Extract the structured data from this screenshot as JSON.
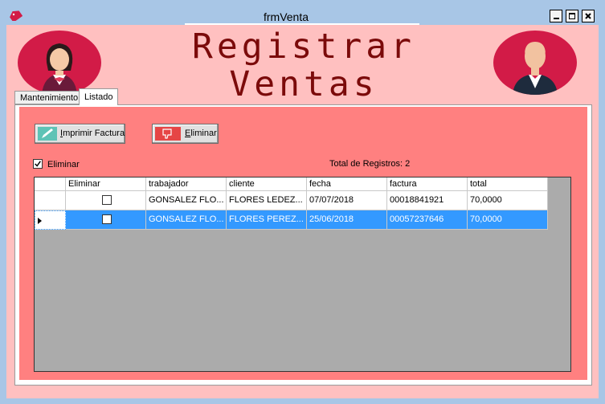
{
  "window": {
    "title": "frmVenta"
  },
  "header": {
    "line1": "Registrar",
    "line2": "Ventas"
  },
  "tabs": [
    {
      "label": "Mantenimiento"
    },
    {
      "label": "Listado"
    }
  ],
  "toolbar": {
    "print_prefix": "I",
    "print_rest": "mprimir Factura",
    "delete_prefix": "E",
    "delete_rest": "liminar"
  },
  "delete_checkbox": {
    "label": "Eliminar",
    "checked": true
  },
  "total": {
    "label": "Total de Registros:",
    "count": "2"
  },
  "table": {
    "columns": [
      "Eliminar",
      "trabajador",
      "cliente",
      "fecha",
      "factura",
      "total"
    ],
    "rows": [
      {
        "eliminar": false,
        "trabajador": "GONSALEZ FLO...",
        "cliente": "FLORES LEDEZ...",
        "fecha": "07/07/2018",
        "factura": "00018841921",
        "total": "70,0000",
        "selected": false
      },
      {
        "eliminar": false,
        "trabajador": "GONSALEZ FLO...",
        "cliente": "FLORES PEREZ...",
        "fecha": "25/06/2018",
        "factura": "00057237646",
        "total": "70,0000",
        "selected": true
      }
    ]
  },
  "colors": {
    "background": "#ffc0c0",
    "panel": "#ff8080",
    "heading": "#7b0a0a",
    "avatar": "#d21b47",
    "selection": "#3399ff"
  }
}
